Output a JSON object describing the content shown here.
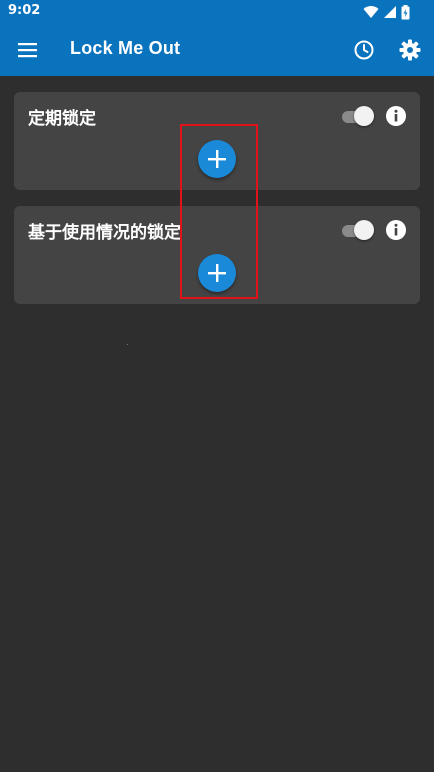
{
  "status_bar": {
    "time": "9:02",
    "icons": [
      "wifi-icon",
      "signal-icon",
      "battery-icon"
    ]
  },
  "app_bar": {
    "title": "Lock Me Out",
    "left_icon": "menu-icon",
    "right_icons": [
      "history-icon",
      "settings-icon"
    ]
  },
  "cards": [
    {
      "title": "定期锁定",
      "toggle_on": true,
      "icons": [
        "info-icon",
        "add-icon"
      ]
    },
    {
      "title": "基于使用情况的锁定",
      "toggle_on": true,
      "icons": [
        "info-icon",
        "add-icon"
      ]
    }
  ],
  "colors": {
    "primary": "#0a73bd",
    "background": "#2e2e2e",
    "card": "#444444",
    "accent": "#1a8ad8",
    "highlight": "#e0121a"
  }
}
